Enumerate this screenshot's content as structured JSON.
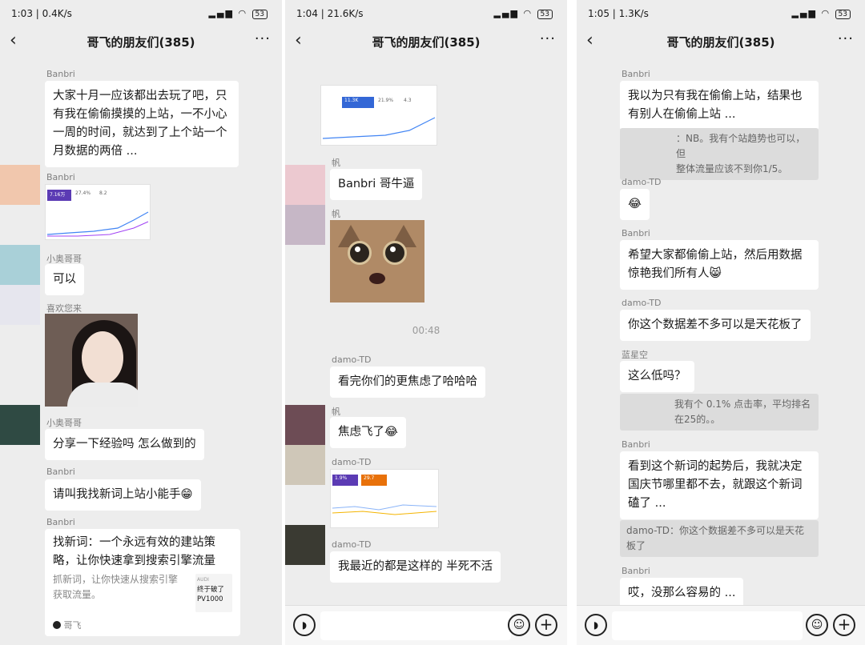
{
  "panel1": {
    "status": {
      "time": "1:03 | 0.4K/s",
      "battery": "53"
    },
    "title": "哥飞的朋友们(385)",
    "messages": [
      {
        "sender": "Banbri",
        "lines": [
          "大家十月一应该都出去玩了吧，只",
          "有我在偷偷摸摸的上站，一不小心",
          "一周的时间，就达到了上个站一个",
          "月数据的两倍 ..."
        ]
      },
      {
        "sender": "Banbri",
        "chart_kpis": [
          "7.16万",
          "27.4%",
          "8.2"
        ]
      },
      {
        "sender": "小奥哥哥",
        "text": "可以"
      },
      {
        "sender": "喜欢您来"
      },
      {
        "sender": "小奥哥哥",
        "text": "分享一下经验吗 怎么做到的"
      },
      {
        "sender": "Banbri",
        "text": "请叫我找新词上站小能手😁"
      },
      {
        "sender": "Banbri",
        "card": {
          "title_lines": [
            "找新词：一个永远有效的建站策",
            "略，让你快速拿到搜索引擎流量"
          ],
          "desc_lines": [
            "抓新词，让你快速从搜索引擎",
            "获取流量。"
          ],
          "thumb_tag": "AUDI",
          "thumb_lines": [
            "终于破了",
            "PV1000"
          ],
          "source": "哥飞"
        }
      }
    ]
  },
  "panel2": {
    "status": {
      "time": "1:04 | 21.6K/s",
      "battery": "53"
    },
    "title": "哥飞的朋友们(385)",
    "top_chart_kpis": [
      "11.3K",
      "21.9%",
      "4.3"
    ],
    "messages": [
      {
        "sender": "帆",
        "text": "Banbri 哥牛逼"
      },
      {
        "sender": "帆"
      },
      {
        "sender": "damo-TD",
        "text": "看完你们的更焦虑了哈哈哈"
      },
      {
        "sender": "帆",
        "text": "焦虑飞了😂"
      },
      {
        "sender": "damo-TD",
        "chart_kpis": [
          "1.9%",
          "29.7"
        ]
      },
      {
        "sender": "damo-TD",
        "text": "我最近的都是这样的 半死不活"
      }
    ],
    "timestamp": "00:48"
  },
  "panel3": {
    "status": {
      "time": "1:05 | 1.3K/s",
      "battery": "53"
    },
    "title": "哥飞的朋友们(385)",
    "messages": [
      {
        "sender": "Banbri",
        "lines": [
          "我以为只有我在偷偷上站，结果也",
          "有别人在偷偷上站 ..."
        ],
        "quote_lines": [
          "：NB。我有个站趋势也可以，但",
          "整体流量应该不到你1/5。"
        ]
      },
      {
        "sender": "damo-TD",
        "text": "😂"
      },
      {
        "sender": "Banbri",
        "lines": [
          "希望大家都偷偷上站，然后用数据",
          "惊艳我们所有人😸"
        ]
      },
      {
        "sender": "damo-TD",
        "text": "你这个数据差不多可以是天花板了"
      },
      {
        "sender": "蓝星空",
        "text": "这么低吗？",
        "quote_lines": [
          "我有个 0.1% 点击率，平均排名",
          "在25的。。"
        ]
      },
      {
        "sender": "Banbri",
        "lines": [
          "看到这个新词的起势后，我就决定",
          "国庆节哪里都不去，就跟这个新词",
          "磕了 ..."
        ],
        "quote_lines": [
          "damo-TD：你这个数据差不多可以是天花",
          "板了"
        ]
      },
      {
        "sender": "Banbri",
        "text": "哎，没那么容易的 ..."
      }
    ]
  },
  "colors": {
    "chat_bg": "#ededed",
    "bubble_bg": "#ffffff",
    "quote_bg": "#dcdcdc",
    "kpi_purple": "#5b3bb4",
    "kpi_orange": "#e8710a",
    "kpi_blue": "#3367d6"
  },
  "icons": [
    "back-arrow-icon",
    "more-dots-icon",
    "voice-icon",
    "emoji-icon",
    "plus-icon",
    "signal-icon",
    "wifi-icon",
    "battery-icon",
    "cat-sticker"
  ]
}
